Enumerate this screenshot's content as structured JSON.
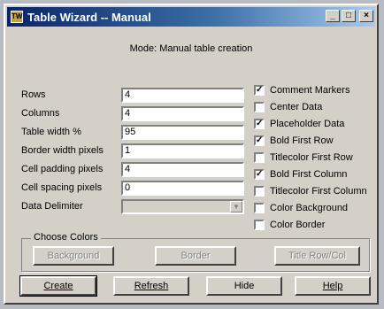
{
  "window": {
    "title": "Table Wizard -- Manual",
    "icon_text": "TW"
  },
  "mode_text": "Mode: Manual table creation",
  "fields": [
    {
      "label": "Rows",
      "value": "4"
    },
    {
      "label": "Columns",
      "value": "4"
    },
    {
      "label": "Table width %",
      "value": "95"
    },
    {
      "label": "Border width pixels",
      "value": "1"
    },
    {
      "label": "Cell padding pixels",
      "value": "4"
    },
    {
      "label": "Cell spacing pixels",
      "value": "0"
    },
    {
      "label": "Data Delimiter",
      "value": ""
    }
  ],
  "checkboxes": [
    {
      "label": "Comment Markers",
      "checked": true
    },
    {
      "label": "Center Data",
      "checked": false
    },
    {
      "label": "Placeholder Data",
      "checked": true
    },
    {
      "label": "Bold First Row",
      "checked": true
    },
    {
      "label": "Titlecolor First Row",
      "checked": false
    },
    {
      "label": "Bold First Column",
      "checked": true
    },
    {
      "label": "Titlecolor First Column",
      "checked": false
    },
    {
      "label": "Color Background",
      "checked": false
    },
    {
      "label": "Color Border",
      "checked": false
    }
  ],
  "colors_group": {
    "title": "Choose Colors",
    "buttons": [
      "Background",
      "Border",
      "Title Row/Col"
    ]
  },
  "actions": [
    "Create",
    "Refresh",
    "Hide",
    "Help"
  ],
  "check_glyph": "✓",
  "colors": {
    "title_start": "#0a246a",
    "title_end": "#a6caf0",
    "face": "#d4d0c8"
  }
}
